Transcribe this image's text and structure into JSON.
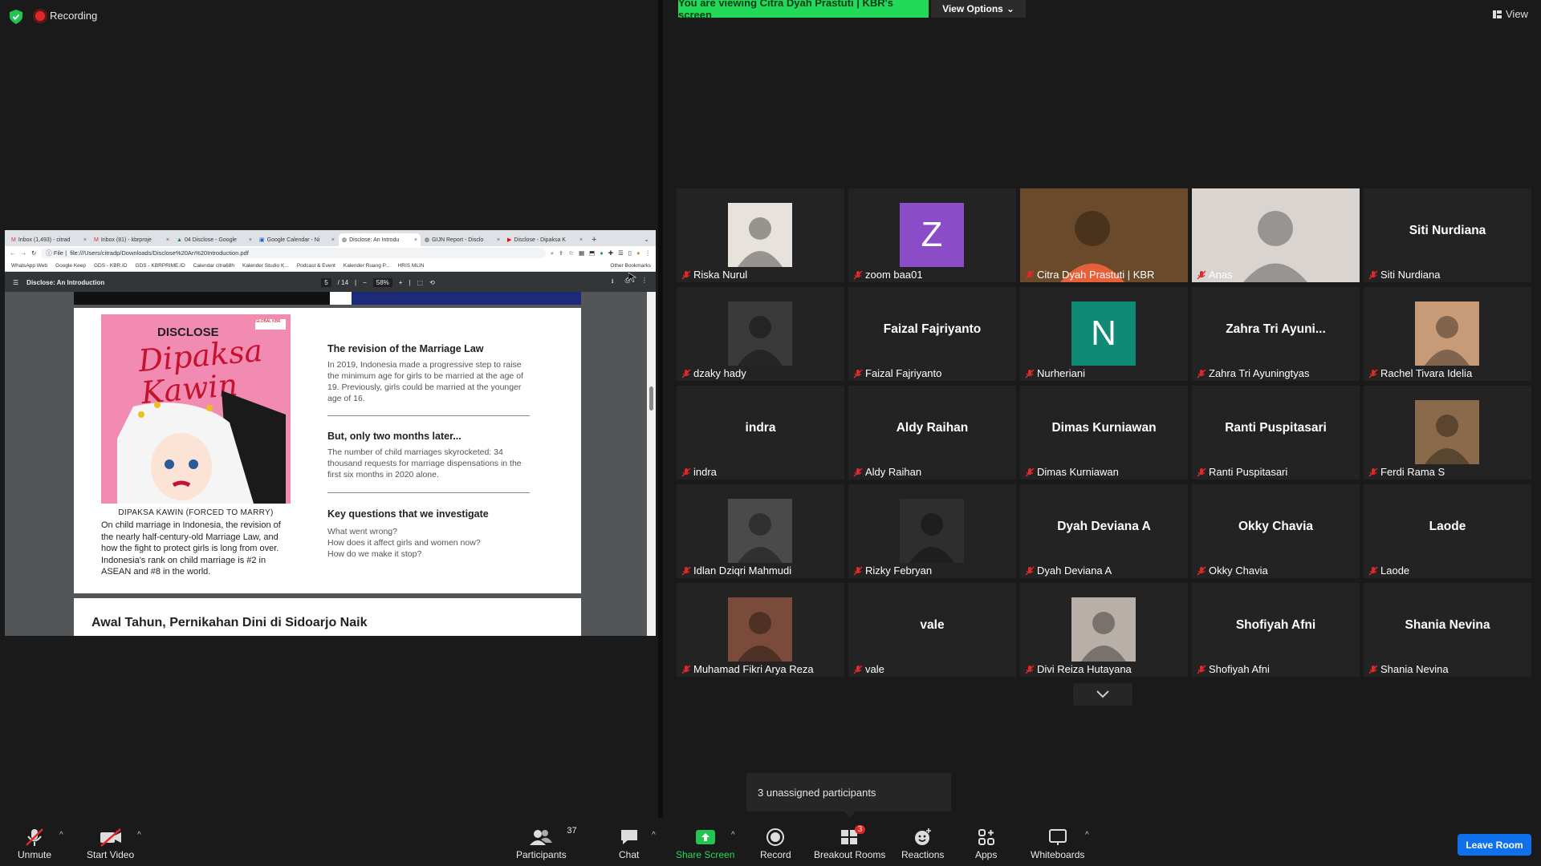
{
  "status": {
    "recording_label": "Recording"
  },
  "banner": {
    "viewing_text": "You are viewing Citra Dyah Prastuti | KBR's screen",
    "view_options": "View Options",
    "view_label": "View"
  },
  "browser": {
    "tabs": [
      "Inbox (1,493) - citrad",
      "Inbox (81) - kbrproje",
      "04 Disclose - Google",
      "Google Calendar - Ni",
      "Disclose: An Introdu",
      "GIJN Report - Disclo",
      "Disclose - Dipaksa K"
    ],
    "url_prefix": "File",
    "url": "file:///Users/citradp/Downloads/Disclose%20An%20Introduction.pdf",
    "bookmarks": [
      "WhatsApp Web",
      "Google Keep",
      "GDS - KBR.ID",
      "GDS - KBRPRIME.ID",
      "Calendar citra68h",
      "Kalender Studio K...",
      "Podcast & Event",
      "Kalender Ruang P...",
      "HRIS MLIN"
    ],
    "other_bookmarks": "Other Bookmarks",
    "pdf_title": "Disclose: An Introduction",
    "page_current": "5",
    "page_total": "/ 14",
    "zoom": "58%"
  },
  "pdf": {
    "poster_disclose": "DISCLOSE",
    "poster_title": "Dipaksa Kawin",
    "poster_badge": "GLOBAL KBR",
    "caption": "DIPAKSA KAWIN (FORCED TO MARRY)",
    "body": "On child marriage in Indonesia, the revision of the nearly half-century-old Marriage Law, and how the fight to protect girls is long from over. Indonesia's rank on child marriage is #2 in ASEAN and #8 in the world.",
    "s1_title": "The revision of the Marriage Law",
    "s1_body": "In 2019, Indonesia made a progressive step to raise the minimum age for girls to be married at the age of 19. Previously, girls could be married at the younger age of 16.",
    "s2_title": "But, only two months later...",
    "s2_body": "The number of child marriages skyrocketed: 34 thousand requests for marriage dispensations in the first six months in 2020 alone.",
    "s3_title": "Key questions that we investigate",
    "s3_q1": "What went wrong?",
    "s3_q2": "How does it affect girls and women now?",
    "s3_q3": "How do we make it stop?",
    "next_page_heading": "Awal Tahun, Pernikahan Dini di Sidoarjo Naik"
  },
  "participants": [
    {
      "name": "Riska Nurul",
      "display": "",
      "kind": "photo",
      "color": "#e8e2dc"
    },
    {
      "name": "zoom baa01",
      "display": "Z",
      "kind": "letter",
      "color": "#8b4cc7"
    },
    {
      "name": "Citra Dyah Prastuti | KBR",
      "display": "",
      "kind": "video",
      "color": "#6a4a2a"
    },
    {
      "name": "Anas",
      "display": "",
      "kind": "video",
      "color": "#d9d4d0"
    },
    {
      "name": "Siti Nurdiana",
      "display": "Siti Nurdiana",
      "kind": "text",
      "color": ""
    },
    {
      "name": "dzaky hady",
      "display": "",
      "kind": "photo",
      "color": "#3a3a3a"
    },
    {
      "name": "Faizal Fajriyanto",
      "display": "Faizal Fajriyanto",
      "kind": "text",
      "color": ""
    },
    {
      "name": "Nurheriani",
      "display": "N",
      "kind": "letter",
      "color": "#0f8a76"
    },
    {
      "name": "Zahra Tri Ayuningtyas",
      "display": "Zahra Tri Ayuni...",
      "kind": "text",
      "color": ""
    },
    {
      "name": "Rachel Tivara Idelia",
      "display": "",
      "kind": "photo",
      "color": "#c79a78"
    },
    {
      "name": "indra",
      "display": "indra",
      "kind": "text",
      "color": ""
    },
    {
      "name": "Aldy Raihan",
      "display": "Aldy Raihan",
      "kind": "text",
      "color": ""
    },
    {
      "name": "Dimas Kurniawan",
      "display": "Dimas Kurniawan",
      "kind": "text",
      "color": ""
    },
    {
      "name": "Ranti Puspitasari",
      "display": "Ranti Puspitasari",
      "kind": "text",
      "color": ""
    },
    {
      "name": "Ferdi Rama S",
      "display": "",
      "kind": "photo",
      "color": "#8a6a4a"
    },
    {
      "name": "Idlan Dziqri Mahmudi",
      "display": "",
      "kind": "photo",
      "color": "#4a4a4a"
    },
    {
      "name": "Rizky Febryan",
      "display": "",
      "kind": "photo",
      "color": "#2e2e2e"
    },
    {
      "name": "Dyah Deviana A",
      "display": "Dyah Deviana A",
      "kind": "text",
      "color": ""
    },
    {
      "name": "Okky Chavia",
      "display": "Okky Chavia",
      "kind": "text",
      "color": ""
    },
    {
      "name": "Laode",
      "display": "Laode",
      "kind": "text",
      "color": ""
    },
    {
      "name": "Muhamad Fikri Arya Reza",
      "display": "",
      "kind": "photo",
      "color": "#7a4a3a"
    },
    {
      "name": "vale",
      "display": "vale",
      "kind": "text",
      "color": ""
    },
    {
      "name": "Divi Reiza Hutayana",
      "display": "",
      "kind": "photo",
      "color": "#b8b0a8"
    },
    {
      "name": "Shofiyah Afni",
      "display": "Shofiyah Afni",
      "kind": "text",
      "color": ""
    },
    {
      "name": "Shania Nevina",
      "display": "Shania Nevina",
      "kind": "text",
      "color": ""
    }
  ],
  "tooltip": "3 unassigned participants",
  "toolbar": {
    "unmute": "Unmute",
    "start_video": "Start Video",
    "participants": "Participants",
    "participants_count": "37",
    "chat": "Chat",
    "share_screen": "Share Screen",
    "record": "Record",
    "breakout_rooms": "Breakout Rooms",
    "breakout_badge": "3",
    "reactions": "Reactions",
    "apps": "Apps",
    "whiteboards": "Whiteboards",
    "leave": "Leave Room"
  },
  "colors": {
    "share_green": "#23d959",
    "leave_blue": "#0e71eb",
    "active_speaker": "#f2e600",
    "muted_red": "#e02828"
  }
}
